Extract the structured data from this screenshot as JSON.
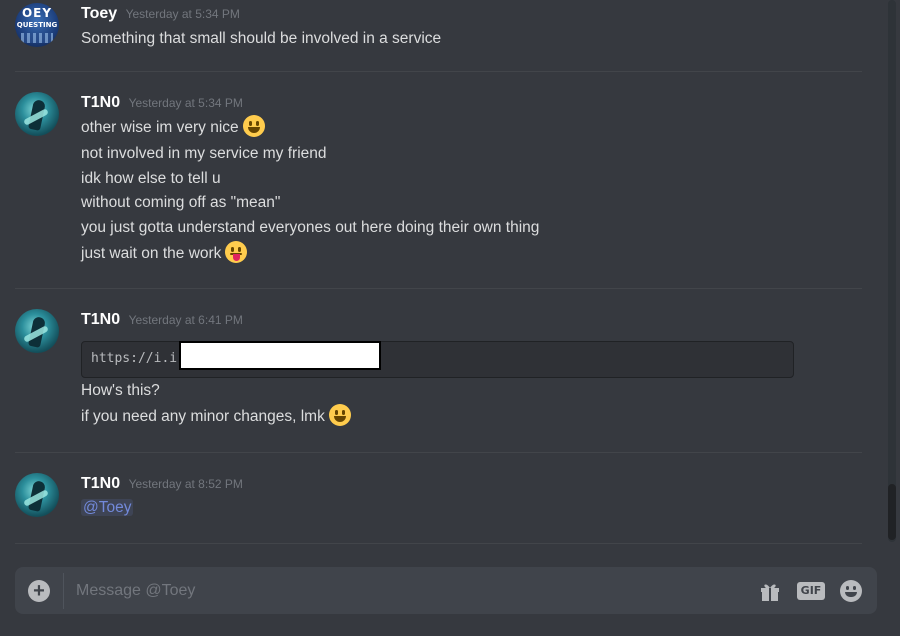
{
  "messages": [
    {
      "author": "Toey",
      "timestamp": "Yesterday at 5:34 PM",
      "avatar": {
        "icon": "toey-questing-avatar",
        "text_line1": "OEY",
        "text_line2": "QUESTING"
      },
      "lines": [
        {
          "text": "Something that small should be involved in a service"
        }
      ]
    },
    {
      "author": "T1N0",
      "timestamp": "Yesterday at 5:34 PM",
      "avatar": {
        "icon": "tino-character-avatar"
      },
      "lines": [
        {
          "text": "other wise im very nice",
          "emoji": "smiley-icon"
        },
        {
          "text": "not involved in my service my friend"
        },
        {
          "text": "idk how else to tell u"
        },
        {
          "text": "without coming off as \"mean\""
        },
        {
          "text": "you just gotta understand everyones out here doing their own thing"
        },
        {
          "text": "just wait on the work",
          "emoji": "stuck-out-tongue-icon"
        }
      ]
    },
    {
      "author": "T1N0",
      "timestamp": "Yesterday at 6:41 PM",
      "avatar": {
        "icon": "tino-character-avatar"
      },
      "code": "https://i.i",
      "lines": [
        {
          "text": "How's this?"
        },
        {
          "text": "if you need any minor changes, lmk",
          "emoji": "smiley-icon"
        }
      ]
    },
    {
      "author": "T1N0",
      "timestamp": "Yesterday at 8:52 PM",
      "avatar": {
        "icon": "tino-character-avatar"
      },
      "lines": [
        {
          "mention": "@Toey"
        }
      ]
    }
  ],
  "composer": {
    "placeholder": "Message @Toey",
    "attach_icon": "plus-circle-icon",
    "gift_icon": "gift-icon",
    "gif_label": "GIF",
    "emoji_icon": "emoji-picker-icon"
  },
  "colors": {
    "background": "#36393f",
    "composer": "#40444b",
    "mention": "#7289da",
    "username": "#ffffff",
    "timestamp": "#72767d"
  }
}
